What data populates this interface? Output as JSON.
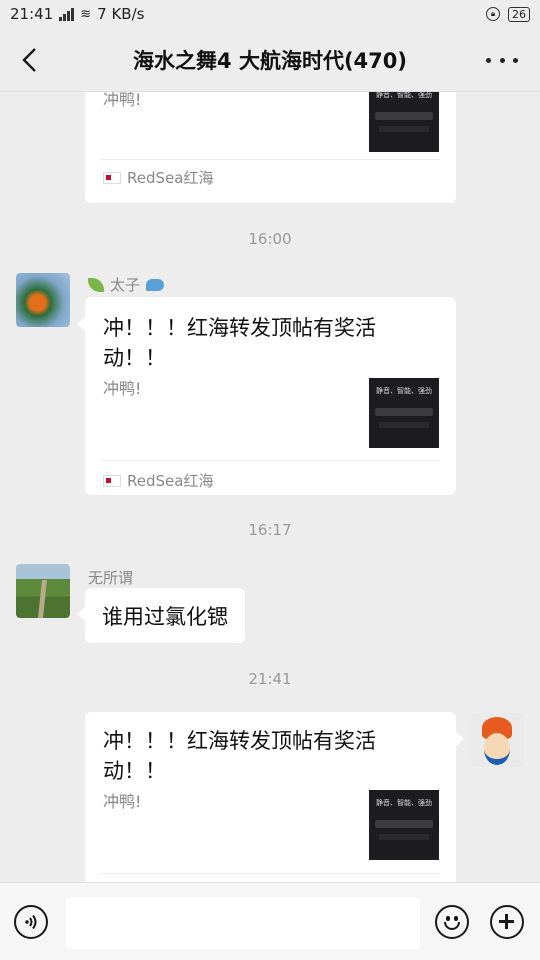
{
  "status_bar": {
    "time": "21:41",
    "network": "3G",
    "speed": "7 KB/s",
    "battery": "26"
  },
  "header": {
    "title": "海水之舞4 大航海时代(470)",
    "back_icon": "back-chevron-icon",
    "more_icon": "more-dots-icon"
  },
  "messages": [
    {
      "type": "link_card_partial",
      "subtitle": "冲鸭!",
      "thumb_text": "静音、智能、强劲",
      "source": "RedSea红海"
    },
    {
      "type": "time",
      "text": "16:00"
    },
    {
      "type": "link_card",
      "sender": "太子",
      "title": "冲！！！红海转发顶帖有奖活动！！",
      "subtitle": "冲鸭!",
      "thumb_text": "静音、智能、强劲",
      "source": "RedSea红海"
    },
    {
      "type": "time",
      "text": "16:17"
    },
    {
      "type": "text",
      "sender": "无所谓",
      "text": "谁用过氯化锶"
    },
    {
      "type": "time",
      "text": "21:41"
    },
    {
      "type": "link_card_self",
      "title": "冲！！！红海转发顶帖有奖活动！！",
      "subtitle": "冲鸭!",
      "thumb_text": "静音、智能、强劲"
    }
  ],
  "input_bar": {
    "voice_icon": "voice-icon",
    "emoji_icon": "emoji-icon",
    "plus_icon": "plus-icon",
    "placeholder": ""
  }
}
